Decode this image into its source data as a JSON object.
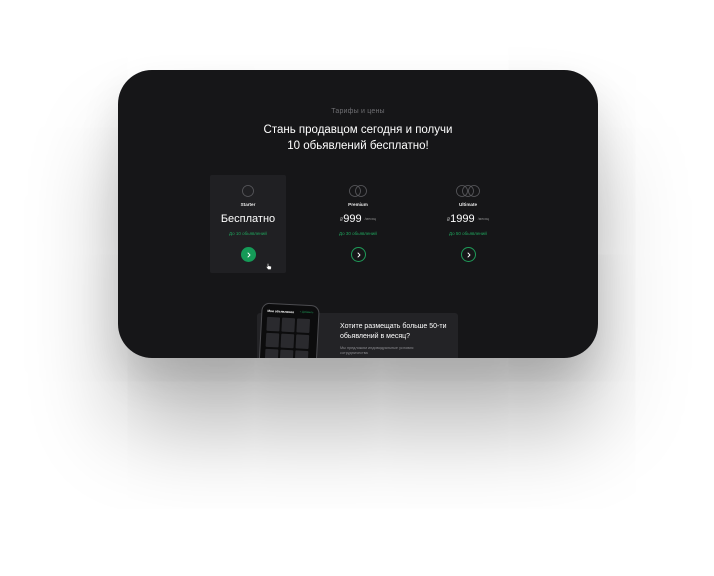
{
  "section": {
    "eyebrow": "Тарифы и цены",
    "headline_line1": "Стань продавцом сегодня и получи",
    "headline_line2": "10 обьявлений бесплатно!"
  },
  "plans": [
    {
      "name": "Starter",
      "price": "Бесплатно",
      "currency": "",
      "period": "",
      "note": "До 10 обьявлений",
      "active": true
    },
    {
      "name": "Premium",
      "price": "999",
      "currency": "₽",
      "period": "/месяц",
      "note": "До 30 обьявлений",
      "active": false
    },
    {
      "name": "Ultimate",
      "price": "1999",
      "currency": "₽",
      "period": "/месяц",
      "note": "До 50 обьявлений",
      "active": false
    }
  ],
  "promo": {
    "title": "Хотите размещать больше 50-ти обьявлений в месяц?",
    "text": "Мы предложим индивидуальные условия сотрудничества",
    "phone_header": "Мои обьявления",
    "phone_badge": "+ Добавить"
  },
  "colors": {
    "background": "#161618",
    "accent": "#159a57",
    "accent_text": "#1fa15b"
  },
  "icons": {
    "starter": "single-ring-icon",
    "premium": "double-ring-icon",
    "ultimate": "triple-ring-icon",
    "button": "chevron-right-icon",
    "cursor": "hand-pointer-icon"
  }
}
